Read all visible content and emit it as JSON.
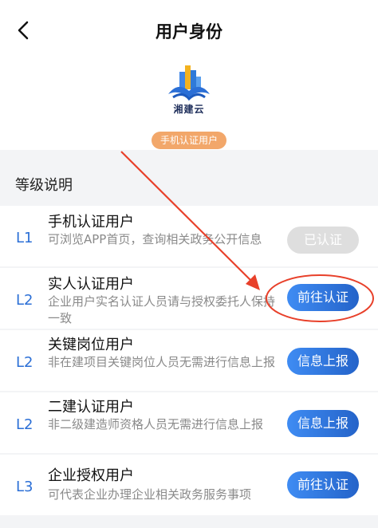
{
  "header": {
    "title": "用户身份",
    "back_icon": "chevron-left-icon"
  },
  "logo": {
    "text": "湘建云"
  },
  "current_level_badge": "手机认证用户",
  "section_title": "等级说明",
  "levels": [
    {
      "level": "L1",
      "name": "手机认证用户",
      "desc": "可浏览APP首页，查询相关政务公开信息",
      "button": "已认证",
      "enabled": false
    },
    {
      "level": "L2",
      "name": "实人认证用户",
      "desc": "企业用户实名认证人员请与授权委托人保持一致",
      "button": "前往认证",
      "enabled": true
    },
    {
      "level": "L2",
      "name": "关键岗位用户",
      "desc": "非在建项目关键岗位人员无需进行信息上报",
      "button": "信息上报",
      "enabled": true
    },
    {
      "level": "L2",
      "name": "二建认证用户",
      "desc": "非二级建造师资格人员无需进行信息上报",
      "button": "信息上报",
      "enabled": true
    },
    {
      "level": "L3",
      "name": "企业授权用户",
      "desc": "可代表企业办理企业相关政务服务事项",
      "button": "前往认证",
      "enabled": true
    }
  ],
  "colors": {
    "accent": "#2b6fd6",
    "badge": "#f2a76a",
    "annotation": "#e8402a"
  }
}
